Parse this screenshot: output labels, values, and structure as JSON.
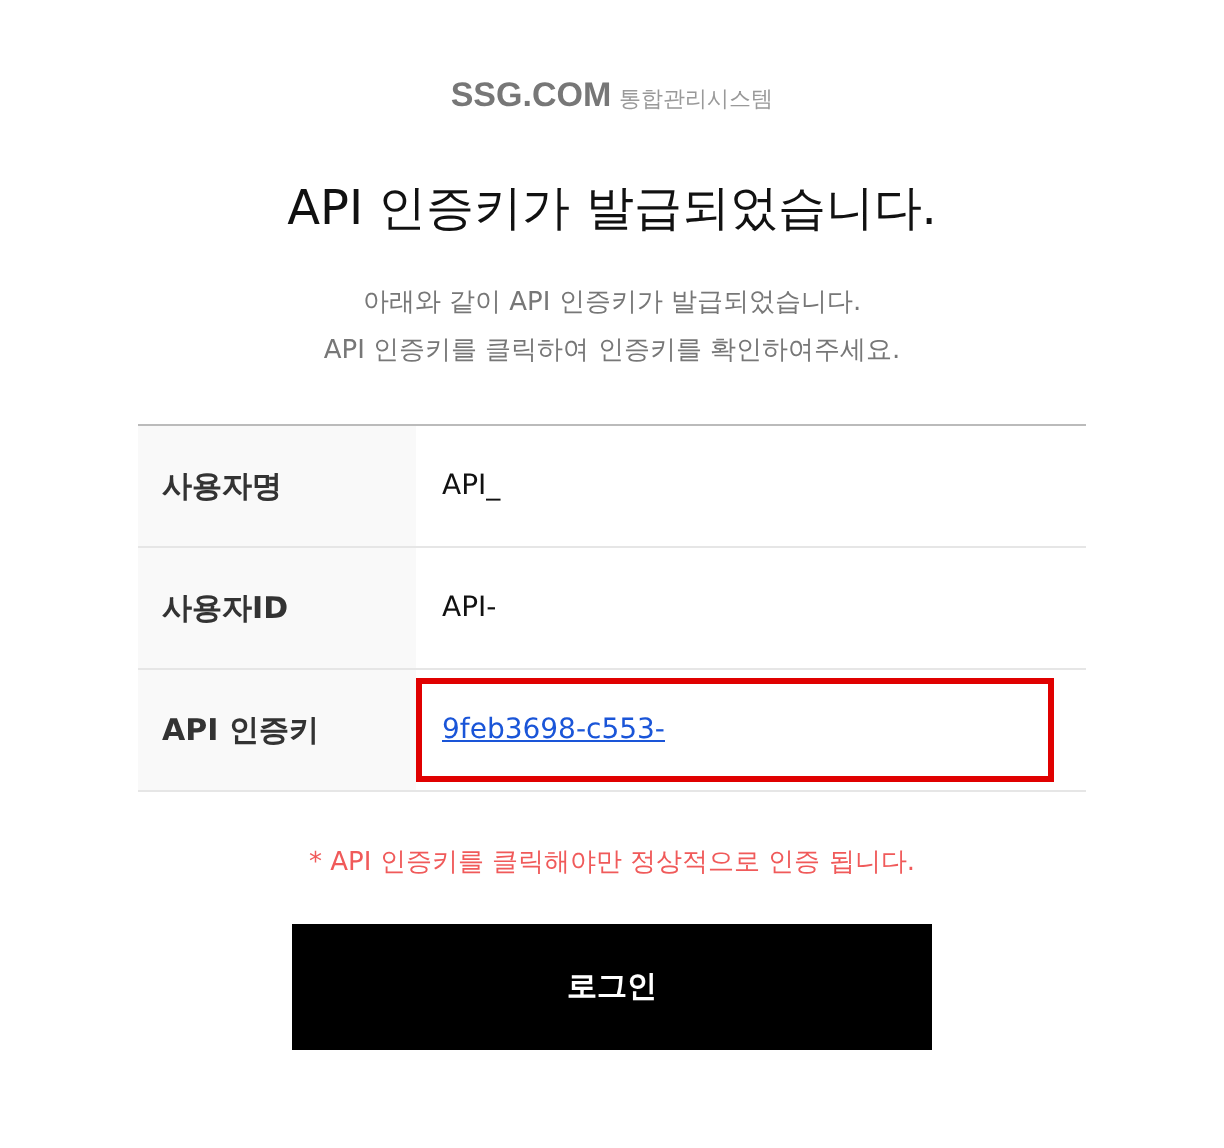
{
  "brand": {
    "logo": "SSG.COM",
    "system": "통합관리시스템"
  },
  "title": "API 인증키가 발급되었습니다.",
  "description": [
    "아래와 같이 API 인증키가 발급되었습니다.",
    "API 인증키를 클릭하여 인증키를 확인하여주세요."
  ],
  "fields": [
    {
      "label": "사용자명",
      "value": "API_",
      "kind": "text",
      "highlighted": false
    },
    {
      "label": "사용자ID",
      "value": "API-",
      "kind": "text",
      "highlighted": false
    },
    {
      "label": "API 인증키",
      "value": "9feb3698-c553-",
      "kind": "link",
      "highlighted": true
    }
  ],
  "notice": "* API 인증키를 클릭해야만 정상적으로 인증 됩니다.",
  "login_button": "로그인"
}
